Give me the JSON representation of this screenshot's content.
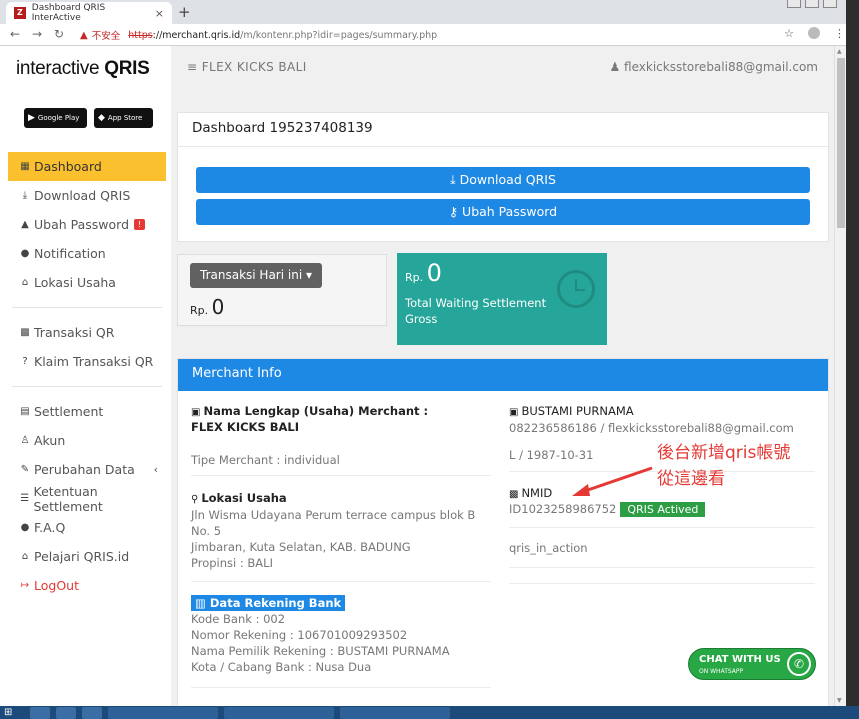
{
  "browser": {
    "tab_title": "Dashboard QRIS InterActive",
    "tab_close": "×",
    "new_tab": "+",
    "unsafe_label": "不安全",
    "url_scheme": "https",
    "url_host": "://merchant.qris.id",
    "url_path": "/m/kontenr.php?idir=pages/summary.php"
  },
  "sidebar": {
    "logo_text": "interactive",
    "logo_bold": "QRIS",
    "google_play": "Google Play",
    "app_store": "App Store",
    "items": [
      {
        "label": "Dashboard"
      },
      {
        "label": "Download QRIS"
      },
      {
        "label": "Ubah Password",
        "badge": "!"
      },
      {
        "label": "Notification"
      },
      {
        "label": "Lokasi Usaha"
      },
      {
        "label": "Transaksi QR"
      },
      {
        "label": "Klaim Transaksi QR"
      },
      {
        "label": "Settlement"
      },
      {
        "label": "Akun"
      },
      {
        "label": "Perubahan Data"
      },
      {
        "label": "Ketentuan Settlement"
      },
      {
        "label": "F.A.Q"
      },
      {
        "label": "Pelajari QRIS.id"
      },
      {
        "label": "LogOut"
      }
    ]
  },
  "header": {
    "brand": "FLEX KICKS BALI",
    "user_email": "flexkicksstorebali88@gmail.com"
  },
  "dashboard": {
    "title": "Dashboard 195237408139",
    "download_button": "Download QRIS",
    "password_button": "Ubah Password",
    "transaksi_dropdown": "Transaksi Hari ini",
    "rp_label": "Rp.",
    "transaksi_value": "0",
    "waiting_value": "0",
    "waiting_label": "Total Waiting Settlement Gross"
  },
  "merchant": {
    "header": "Merchant Info",
    "nama_label": "Nama Lengkap (Usaha) Merchant :",
    "nama_value": "FLEX KICKS BALI",
    "tipe": "Tipe Merchant : individual",
    "lokasi_label": "Lokasi Usaha",
    "lokasi_1": "Jln Wisma Udayana Perum terrace campus blok B",
    "lokasi_2": "No. 5",
    "lokasi_3": "Jimbaran, Kuta Selatan, KAB. BADUNG",
    "lokasi_4": "Propinsi : BALI",
    "owner_name": "BUSTAMI PURNAMA",
    "owner_contact": "082236586186 / flexkicksstorebali88@gmail.com",
    "owner_dob": "L / 1987-10-31",
    "nmid_label": "NMID",
    "nmid_value": "ID1023258986752",
    "nmid_status": "QRIS Actived",
    "qris_tag": "qris_in_action",
    "bank_header": "Data Rekening Bank",
    "bank_kode": "Kode Bank : 002",
    "bank_nomor": "Nomor Rekening : 106701009293502",
    "bank_pemilik": "Nama Pemilik Rekening : BUSTAMI PURNAMA",
    "bank_kota": "Kota / Cabang Bank : Nusa Dua"
  },
  "annotation": {
    "line1": "後台新增qris帳號",
    "line2": "從這邊看"
  },
  "chat": {
    "line1": "CHAT WITH US",
    "line2": "ON WHATSAPP"
  },
  "colors": {
    "primary": "#1e88e5",
    "active": "#fbc02d",
    "teal": "#26a69a",
    "success": "#2e9e45",
    "danger": "#e53935"
  }
}
